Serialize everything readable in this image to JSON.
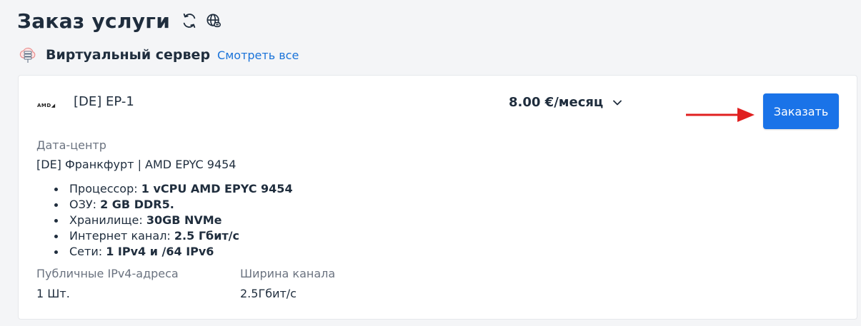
{
  "header": {
    "title": "Заказ услуги",
    "icons": [
      "refresh-icon",
      "globe-link-icon"
    ]
  },
  "section": {
    "icon": "cloud-server-icon",
    "title": "Виртуальный сервер",
    "see_all": "Смотреть все"
  },
  "card": {
    "logo_text": "AMD",
    "plan_name": "[DE] EP-1",
    "price": "8.00 €/месяц",
    "order_button": "Заказать",
    "datacenter_label": "Дата-центр",
    "datacenter_value": "[DE] Франкфурт | AMD EPYC 9454",
    "specs": [
      {
        "label": "Процессор: ",
        "value": "1 vCPU AMD EPYC 9454"
      },
      {
        "label": "ОЗУ: ",
        "value": "2 GB DDR5."
      },
      {
        "label": "Хранилище: ",
        "value": "30GB NVMe"
      },
      {
        "label": "Интернет канал: ",
        "value": "2.5 Гбит/с"
      },
      {
        "label": "Сети: ",
        "value": "1 IPv4 и /64 IPv6"
      }
    ],
    "ipv4_label": "Публичные IPv4-адреса",
    "ipv4_value": "1 Шт.",
    "bandwidth_label": "Ширина канала",
    "bandwidth_value": "2.5Гбит/с"
  },
  "colors": {
    "accent": "#1a73e8",
    "link": "#1a73d9",
    "arrow": "#e02020",
    "text": "#1f2d3d",
    "muted": "#6b7380"
  }
}
